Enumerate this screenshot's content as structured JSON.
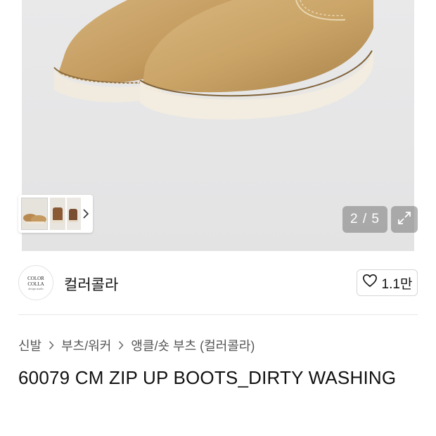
{
  "gallery": {
    "image_alt": "boots-photo",
    "counter": "2 / 5",
    "icons": {
      "thumb_next": "chevron-right-icon",
      "expand": "expand-icon"
    }
  },
  "brand": {
    "logo_line1": "COLOR",
    "logo_line2": "COLLA",
    "logo_line3": "design studio",
    "name": "컬러콜라",
    "like_count": "1.1만",
    "like_icon": "heart-outline-icon"
  },
  "breadcrumb": {
    "items": [
      "신발",
      "부츠/워커",
      "앵클/숏 부츠 (컬러콜라)"
    ],
    "separator_icon": "chevron-right-icon"
  },
  "product": {
    "title": "60079 CM ZIP UP BOOTS_DIRTY WASHING"
  },
  "colors": {
    "suede": "#c9a66b",
    "sole": "#f3ece0",
    "overlay": "#787878"
  }
}
